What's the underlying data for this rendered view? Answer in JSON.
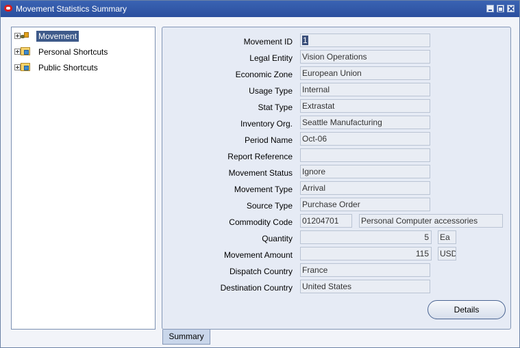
{
  "window": {
    "title": "Movement Statistics Summary"
  },
  "navigator": {
    "items": [
      {
        "label": "Movement",
        "selected": true,
        "icon": "movement-icon"
      },
      {
        "label": "Personal Shortcuts",
        "selected": false,
        "icon": "folder-icon"
      },
      {
        "label": "Public Shortcuts",
        "selected": false,
        "icon": "folder-icon"
      }
    ]
  },
  "form": {
    "movement_id": {
      "label": "Movement ID",
      "value": "1"
    },
    "legal_entity": {
      "label": "Legal Entity",
      "value": "Vision Operations"
    },
    "economic_zone": {
      "label": "Economic Zone",
      "value": "European Union"
    },
    "usage_type": {
      "label": "Usage Type",
      "value": "Internal"
    },
    "stat_type": {
      "label": "Stat Type",
      "value": "Extrastat"
    },
    "inventory_org": {
      "label": "Inventory Org.",
      "value": "Seattle Manufacturing"
    },
    "period_name": {
      "label": "Period Name",
      "value": "Oct-06"
    },
    "report_reference": {
      "label": "Report Reference",
      "value": ""
    },
    "movement_status": {
      "label": "Movement Status",
      "value": "Ignore"
    },
    "movement_type": {
      "label": "Movement Type",
      "value": "Arrival"
    },
    "source_type": {
      "label": "Source Type",
      "value": "Purchase Order"
    },
    "commodity_code": {
      "label": "Commodity Code",
      "code": "01204701",
      "description": "Personal Computer accessories"
    },
    "quantity": {
      "label": "Quantity",
      "value": "5",
      "uom": "Ea"
    },
    "movement_amount": {
      "label": "Movement Amount",
      "value": "115",
      "currency": "USD"
    },
    "dispatch_country": {
      "label": "Dispatch Country",
      "value": "France"
    },
    "destination_country": {
      "label": "Destination Country",
      "value": "United States"
    },
    "details_button": "Details"
  },
  "tabs": {
    "summary": "Summary"
  }
}
